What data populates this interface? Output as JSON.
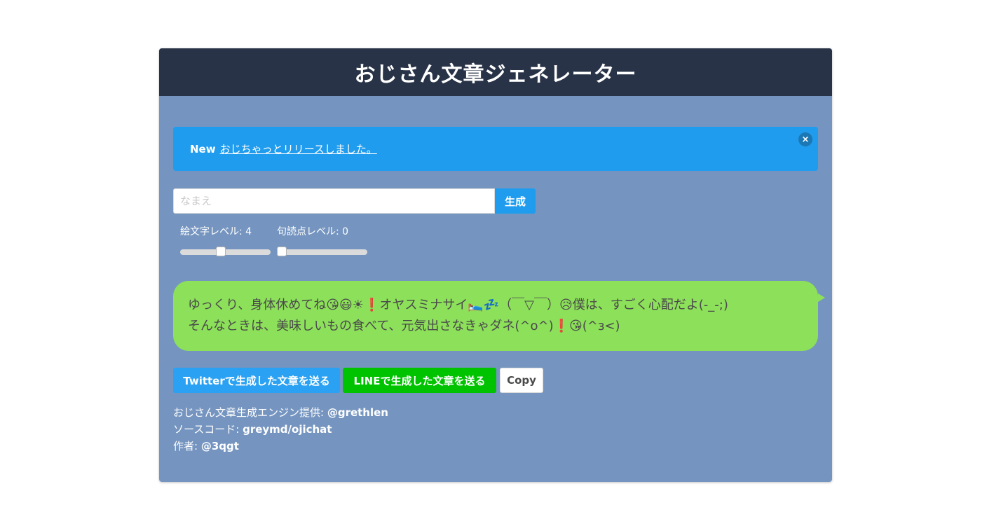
{
  "header": {
    "title": "おじさん文章ジェネレーター"
  },
  "notice": {
    "badge": "New",
    "link_text": "おじちゃっとリリースしました。",
    "close_glyph": "×"
  },
  "form": {
    "name_placeholder": "なまえ",
    "name_value": "",
    "generate_label": "生成"
  },
  "sliders": {
    "emoji": {
      "label": "絵文字レベル: 4",
      "value": 4,
      "fraction": 0.45
    },
    "punct": {
      "label": "句読点レベル: 0",
      "value": 0,
      "fraction": 0.05
    }
  },
  "output": {
    "line1": "ゆっくり、身体休めてね😘😃☀❗オヤスミナサイ🛌💤（￣▽￣）😥僕は、すごく心配だよ(-_-;)",
    "line2": "そんなときは、美味しいもの食べて、元気出さなきゃダネ(^o^)❗😘(^з<)"
  },
  "actions": {
    "twitter_label": "Twitterで生成した文章を送る",
    "line_label": "LINEで生成した文章を送る",
    "copy_label": "Copy"
  },
  "credits": {
    "engine_prefix": "おじさん文章生成エンジン提供: ",
    "engine_name": "@grethlen",
    "source_prefix": "ソースコード: ",
    "source_name": "greymd/ojichat",
    "author_prefix": "作者: ",
    "author_name": "@3qgt"
  },
  "colors": {
    "header_bg": "#283347",
    "card_bg": "#7595c0",
    "notice_bg": "#209cee",
    "bubble_bg": "#8ce05a",
    "twitter": "#2aa1f2",
    "line": "#00c300"
  }
}
